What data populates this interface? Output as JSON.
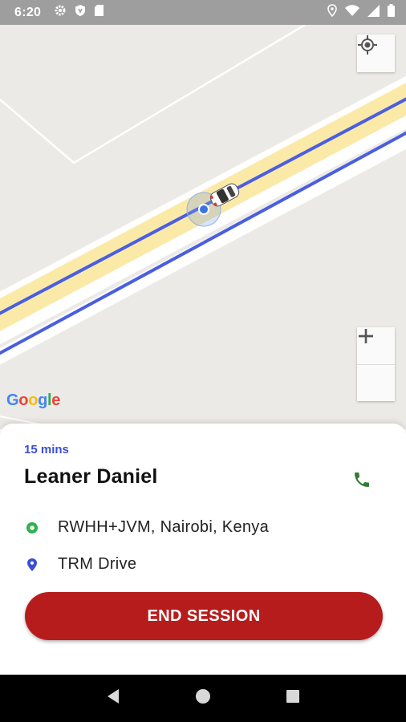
{
  "status_bar": {
    "time": "6:20",
    "left_icons": [
      "gear-icon",
      "shield-icon",
      "sd-card-icon"
    ],
    "right_icons": [
      "location-pin-icon",
      "wifi-icon",
      "signal-icon",
      "battery-icon"
    ]
  },
  "map": {
    "logo_letters": [
      "G",
      "o",
      "o",
      "g",
      "l",
      "e"
    ],
    "controls": [
      "my-location-icon",
      "zoom-in-icon",
      "zoom-out-icon"
    ]
  },
  "trip": {
    "eta": "15 mins",
    "passenger_name": "Leaner Daniel",
    "pickup": "RWHH+JVM, Nairobi, Kenya",
    "dropoff": "TRM Drive",
    "end_button": "END SESSION"
  },
  "colors": {
    "accent_blue": "#3a4fd6",
    "end_button": "#b71c1c",
    "call_green": "#2e7d32",
    "pickup_green": "#2fb24c",
    "route_blue": "#4a5ee0"
  },
  "nav_bar": {
    "buttons": [
      "back-icon",
      "home-icon",
      "recents-icon"
    ]
  }
}
